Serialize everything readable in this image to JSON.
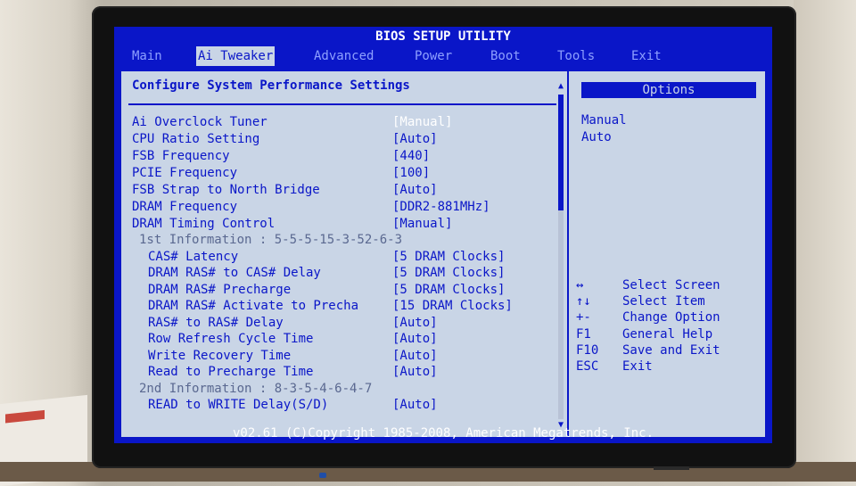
{
  "title": "BIOS SETUP UTILITY",
  "menu": [
    "Main",
    "Ai Tweaker",
    "Advanced",
    "Power",
    "Boot",
    "Tools",
    "Exit"
  ],
  "active_menu": "Ai Tweaker",
  "section_heading": "Configure System Performance Settings",
  "settings": [
    {
      "label": "Ai Overclock Tuner",
      "value": "[Manual]"
    },
    {
      "label": "CPU Ratio Setting",
      "value": "[Auto]"
    },
    {
      "label": "FSB Frequency",
      "value": "[440]"
    },
    {
      "label": "PCIE Frequency",
      "value": "[100]"
    },
    {
      "label": "FSB Strap to North Bridge",
      "value": "[Auto]"
    },
    {
      "label": "DRAM Frequency",
      "value": "[DDR2-881MHz]"
    },
    {
      "label": "DRAM Timing Control",
      "value": "[Manual]"
    },
    {
      "label": "1st Information : 5-5-5-15-3-52-6-3",
      "value": ""
    },
    {
      "label": "CAS# Latency",
      "value": "[5 DRAM Clocks]"
    },
    {
      "label": "DRAM RAS# to CAS# Delay",
      "value": "[5 DRAM Clocks]"
    },
    {
      "label": "DRAM RAS# Precharge",
      "value": "[5 DRAM Clocks]"
    },
    {
      "label": "DRAM RAS# Activate to Precha",
      "value": "[15 DRAM Clocks]"
    },
    {
      "label": "RAS# to RAS# Delay",
      "value": "[Auto]"
    },
    {
      "label": "Row Refresh Cycle Time",
      "value": "[Auto]"
    },
    {
      "label": "Write Recovery Time",
      "value": "[Auto]"
    },
    {
      "label": "Read to Precharge Time",
      "value": "[Auto]"
    },
    {
      "label": "2nd Information : 8-3-5-4-6-4-7",
      "value": ""
    },
    {
      "label": "READ to WRITE Delay(S/D)",
      "value": "[Auto]"
    }
  ],
  "scroll_up_icon": "▲",
  "scroll_down_icon": "▼",
  "options_title": "Options",
  "options": [
    "Manual",
    "Auto"
  ],
  "help": [
    {
      "key": "↔",
      "desc": "Select Screen"
    },
    {
      "key": "↑↓",
      "desc": "Select Item"
    },
    {
      "key": "+-",
      "desc": "Change Option"
    },
    {
      "key": "F1",
      "desc": "General Help"
    },
    {
      "key": "F10",
      "desc": "Save and Exit"
    },
    {
      "key": "ESC",
      "desc": "Exit"
    }
  ],
  "footer": "v02.61 (C)Copyright 1985-2008, American Megatrends, Inc.",
  "colors": {
    "bios_blue": "#0a16c8",
    "panel_gray": "#c9d5e6",
    "highlight": "#ffffff"
  }
}
